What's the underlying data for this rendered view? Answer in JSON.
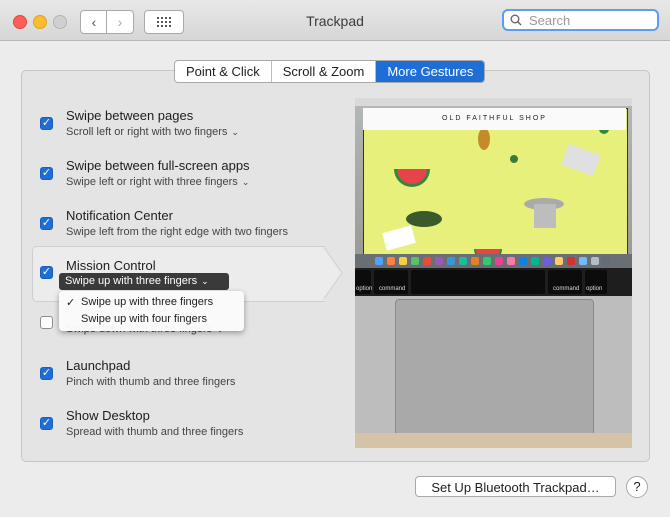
{
  "window": {
    "title": "Trackpad"
  },
  "search": {
    "placeholder": "Search"
  },
  "tabs": [
    {
      "label": "Point & Click"
    },
    {
      "label": "Scroll & Zoom"
    },
    {
      "label": "More Gestures"
    }
  ],
  "gestures": [
    {
      "title": "Swipe between pages",
      "subtitle": "Scroll left or right with two fingers",
      "checked": true
    },
    {
      "title": "Swipe between full-screen apps",
      "subtitle": "Swipe left or right with three fingers",
      "checked": true
    },
    {
      "title": "Notification Center",
      "subtitle": "Swipe left from the right edge with two fingers",
      "checked": true
    },
    {
      "title": "Mission Control",
      "selected": "Swipe up with three fingers",
      "checked": true
    },
    {
      "subtitle": "Swipe down with three fingers",
      "checked": false
    },
    {
      "title": "Launchpad",
      "subtitle": "Pinch with thumb and three fingers",
      "checked": true
    },
    {
      "title": "Show Desktop",
      "subtitle": "Spread with thumb and three fingers",
      "checked": true
    }
  ],
  "menu": {
    "options": [
      {
        "label": "Swipe up with three fingers",
        "checked": true
      },
      {
        "label": "Swipe up with four fingers",
        "checked": false
      }
    ]
  },
  "preview": {
    "shop_title": "OLD FAITHFUL SHOP",
    "keys": [
      "option",
      "command",
      "command",
      "option"
    ]
  },
  "footer": {
    "bluetooth_label": "Set Up Bluetooth Trackpad…",
    "help_label": "?"
  },
  "colors": {
    "accent": "#1f6ed6",
    "search_focus": "#5a9df3"
  },
  "icons": {
    "check": "✓",
    "chevron": "⌄",
    "back": "‹",
    "forward": "›",
    "grid": "⋯",
    "search": "search-icon"
  }
}
